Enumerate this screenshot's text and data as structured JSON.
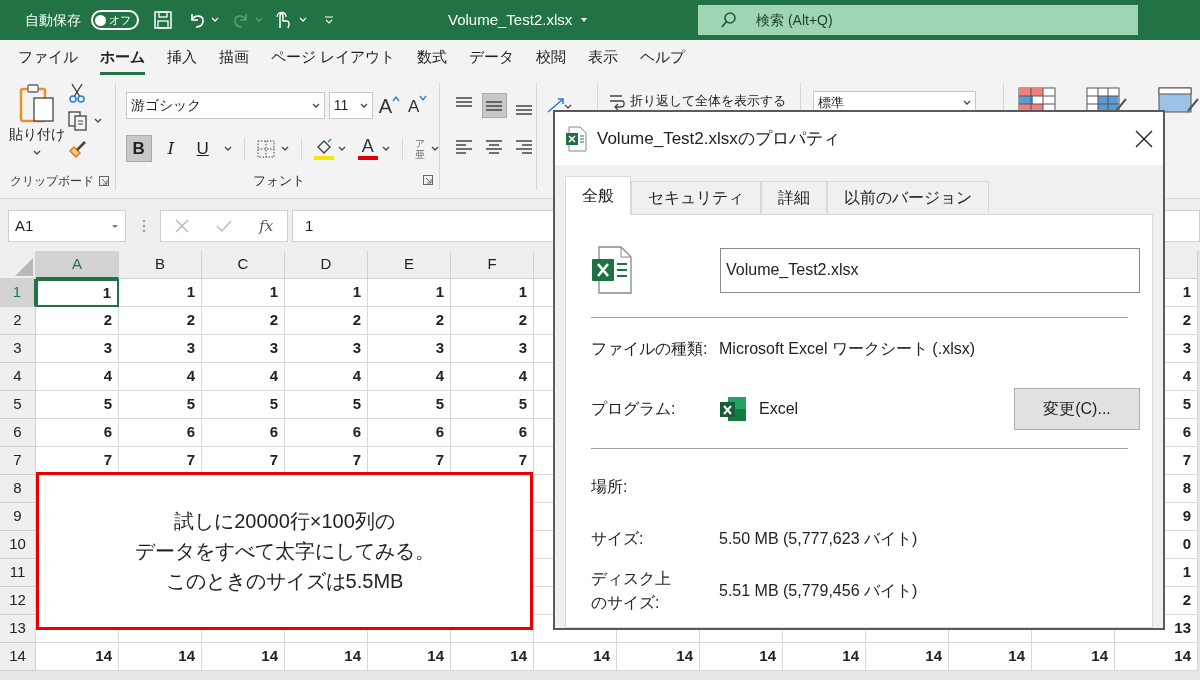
{
  "title_bar": {
    "autosave_label": "自動保存",
    "autosave_toggle": {
      "label": "オフ",
      "on": false
    },
    "file_title": "Volume_Test2.xlsx",
    "search": {
      "placeholder": "検索 (Alt+Q)"
    }
  },
  "menu_tabs": [
    {
      "label": "ファイル",
      "selected": false
    },
    {
      "label": "ホーム",
      "selected": true
    },
    {
      "label": "挿入",
      "selected": false
    },
    {
      "label": "描画",
      "selected": false
    },
    {
      "label": "ページ レイアウト",
      "selected": false
    },
    {
      "label": "数式",
      "selected": false
    },
    {
      "label": "データ",
      "selected": false
    },
    {
      "label": "校閲",
      "selected": false
    },
    {
      "label": "表示",
      "selected": false
    },
    {
      "label": "ヘルプ",
      "selected": false
    }
  ],
  "ribbon": {
    "clipboard": {
      "paste_label": "貼り付け",
      "group_label": "クリップボード"
    },
    "font": {
      "font_name": "游ゴシック",
      "size_box": "11",
      "grow_label": "A",
      "shrink_label": "A",
      "buttons": [
        {
          "kind": "bold",
          "label": "B",
          "selected": true
        },
        {
          "kind": "italic",
          "label": "I",
          "selected": false
        },
        {
          "kind": "underline",
          "label": "U",
          "selected": false
        }
      ],
      "font_color_label": "A",
      "phonetic_label": "ア亜",
      "group_label": "フォント"
    },
    "alignment": [
      {
        "kind": "top",
        "selected": false
      },
      {
        "kind": "middle",
        "selected": true
      },
      {
        "kind": "bottom",
        "selected": false
      },
      {
        "kind": "left",
        "selected": false
      },
      {
        "kind": "center",
        "selected": false
      },
      {
        "kind": "right",
        "selected": false
      }
    ],
    "wrap_text_label": "折り返して全体を表示する",
    "number_format": "標準"
  },
  "formula_bar": {
    "name_box": "A1",
    "function_label": "fx",
    "value": "1"
  },
  "sheet": {
    "column_headers": [
      {
        "label": "A",
        "selected": true
      },
      {
        "label": "B",
        "selected": false
      },
      {
        "label": "C",
        "selected": false
      },
      {
        "label": "D",
        "selected": false
      },
      {
        "label": "E",
        "selected": false
      },
      {
        "label": "F",
        "selected": false
      }
    ],
    "rows": [
      {
        "header": "1",
        "selected": true,
        "cells": [
          "1",
          "1",
          "1",
          "1",
          "1",
          "1"
        ],
        "last_cell": "1"
      },
      {
        "header": "2",
        "selected": false,
        "cells": [
          "2",
          "2",
          "2",
          "2",
          "2",
          "2"
        ],
        "last_cell": "2"
      },
      {
        "header": "3",
        "selected": false,
        "cells": [
          "3",
          "3",
          "3",
          "3",
          "3",
          "3"
        ],
        "last_cell": "3"
      },
      {
        "header": "4",
        "selected": false,
        "cells": [
          "4",
          "4",
          "4",
          "4",
          "4",
          "4"
        ],
        "last_cell": "4"
      },
      {
        "header": "5",
        "selected": false,
        "cells": [
          "5",
          "5",
          "5",
          "5",
          "5",
          "5"
        ],
        "last_cell": "5"
      },
      {
        "header": "6",
        "selected": false,
        "cells": [
          "6",
          "6",
          "6",
          "6",
          "6",
          "6"
        ],
        "last_cell": "6"
      },
      {
        "header": "7",
        "selected": false,
        "cells": [
          "7",
          "7",
          "7",
          "7",
          "7",
          "7"
        ],
        "last_cell": "7"
      },
      {
        "header": "8",
        "selected": false,
        "last_cell": "8"
      },
      {
        "header": "9",
        "selected": false,
        "last_cell": "9"
      },
      {
        "header": "10",
        "selected": false,
        "last_cell": "0"
      },
      {
        "header": "11",
        "selected": false,
        "last_cell": "1"
      },
      {
        "header": "12",
        "selected": false,
        "last_cell": "2"
      },
      {
        "header": "13",
        "selected": false,
        "last_cell": "13"
      },
      {
        "header": "14",
        "selected": false,
        "cells": [
          "14",
          "14",
          "14",
          "14",
          "14",
          "14",
          "14",
          "14",
          "14",
          "14",
          "14",
          "14",
          "14",
          "14"
        ]
      }
    ]
  },
  "callout": {
    "lines": [
      "試しに20000行×100列の",
      "データをすべて太字にしてみる。",
      "このときのサイズは5.5MB"
    ]
  },
  "dialog": {
    "title": "Volume_Test2.xlsxのプロパティ",
    "tabs": [
      {
        "label": "全般",
        "selected": true
      },
      {
        "label": "セキュリティ",
        "selected": false
      },
      {
        "label": "詳細",
        "selected": false
      },
      {
        "label": "以前のバージョン",
        "selected": false
      }
    ],
    "file_name": "Volume_Test2.xlsx",
    "sections": [
      [
        {
          "kind": "text",
          "label": "ファイルの種類:",
          "value": "Microsoft Excel ワークシート (.xlsx)"
        },
        {
          "kind": "program",
          "label": "プログラム:",
          "value": "Excel",
          "button": "変更(C)..."
        }
      ],
      [
        {
          "kind": "text",
          "label": "場所:"
        },
        {
          "kind": "text",
          "label": "サイズ:",
          "value": "5.50 MB (5,777,623 バイト)"
        },
        {
          "kind": "text",
          "label": "ディスク上のサイズ:",
          "value": "5.51 MB (5,779,456 バイト)"
        }
      ]
    ]
  }
}
